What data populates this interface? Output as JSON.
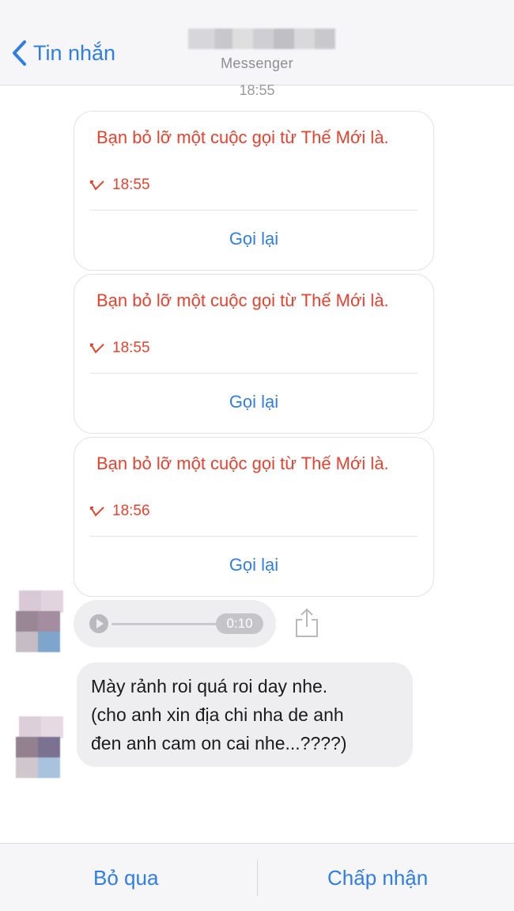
{
  "header": {
    "back_label": "Tin nhắn",
    "subtitle": "Messenger"
  },
  "time_top": "18:55",
  "missed_calls": [
    {
      "text": "Bạn bỏ lỡ một cuộc gọi từ Thế Mới là.",
      "time": "18:55",
      "action": "Gọi lại"
    },
    {
      "text": "Bạn bỏ lỡ một cuộc gọi từ Thế Mới là.",
      "time": "18:55",
      "action": "Gọi lại"
    },
    {
      "text": "Bạn bỏ lỡ một cuộc gọi từ Thế Mới là.",
      "time": "18:56",
      "action": "Gọi lại"
    }
  ],
  "voice_message": {
    "duration": "0:10",
    "progress": 0
  },
  "text_message": {
    "line1": "Mày rảnh roi quá roi day nhe.",
    "line2": "(cho anh xin địa chi nha de anh",
    "line3": "đen anh cam on cai nhe...????)"
  },
  "footer": {
    "ignore_label": "Bỏ qua",
    "accept_label": "Chấp nhận"
  },
  "colors": {
    "accent": "#2f7ee6",
    "missed_call": "#e8412d"
  }
}
